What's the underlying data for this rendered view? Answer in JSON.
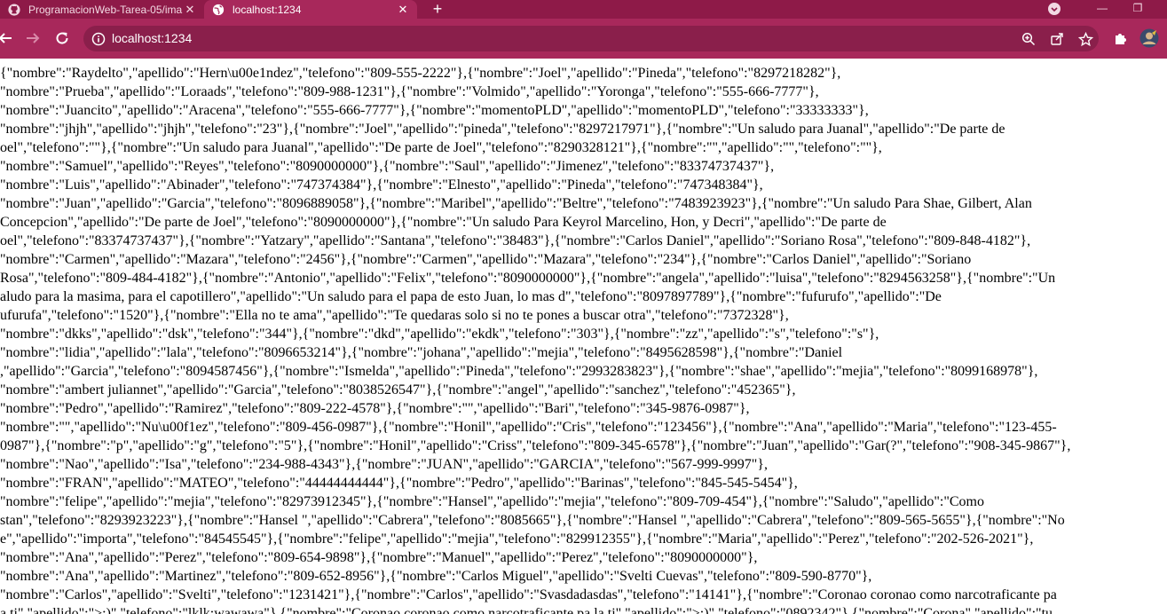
{
  "browser": {
    "tabs": [
      {
        "title": "ProgramacionWeb-Tarea-05/ima",
        "active": false,
        "icon": "github-icon"
      },
      {
        "title": "localhost:1234",
        "active": true,
        "icon": "globe-icon"
      }
    ],
    "address_bar": {
      "url": "localhost:1234",
      "icon": "info-icon"
    },
    "theme": {
      "frame": "#8e1a48",
      "toolbar": "#a8285b",
      "omnibox": "#8a1f4b"
    }
  },
  "page": {
    "lines": [
      "{\"nombre\":\"Raydelto\",\"apellido\":\"Hern\\u00e1ndez\",\"telefono\":\"809-555-2222\"},{\"nombre\":\"Joel\",\"apellido\":\"Pineda\",\"telefono\":\"8297218282\"},",
      "\"nombre\":\"Prueba\",\"apellido\":\"Loraads\",\"telefono\":\"809-988-1231\"},{\"nombre\":\"Volmido\",\"apellido\":\"Yoronga\",\"telefono\":\"555-666-7777\"},",
      "\"nombre\":\"Juancito\",\"apellido\":\"Aracena\",\"telefono\":\"555-666-7777\"},{\"nombre\":\"momentoPLD\",\"apellido\":\"momentoPLD\",\"telefono\":\"33333333\"},",
      "\"nombre\":\"jhjh\",\"apellido\":\"jhjh\",\"telefono\":\"23\"},{\"nombre\":\"Joel\",\"apellido\":\"pineda\",\"telefono\":\"8297217971\"},{\"nombre\":\"Un saludo para Juanal\",\"apellido\":\"De parte de",
      "oel\",\"telefono\":\"\"},{\"nombre\":\"Un saludo para Juanal\",\"apellido\":\"De parte de Joel\",\"telefono\":\"8290328121\"},{\"nombre\":\"\",\"apellido\":\"\",\"telefono\":\"\"},",
      "\"nombre\":\"Samuel\",\"apellido\":\"Reyes\",\"telefono\":\"8090000000\"},{\"nombre\":\"Saul\",\"apellido\":\"Jimenez\",\"telefono\":\"83374737437\"},",
      "\"nombre\":\"Luis\",\"apellido\":\"Abinader\",\"telefono\":\"747374384\"},{\"nombre\":\"Elnesto\",\"apellido\":\"Pineda\",\"telefono\":\"747348384\"},",
      "\"nombre\":\"Juan\",\"apellido\":\"Garcia\",\"telefono\":\"8096889058\"},{\"nombre\":\"Maribel\",\"apellido\":\"Beltre\",\"telefono\":\"7483923923\"},{\"nombre\":\"Un saludo Para Shae, Gilbert, Alan",
      "Concepcion\",\"apellido\":\"De parte de Joel\",\"telefono\":\"8090000000\"},{\"nombre\":\"Un saludo Para Keyrol Marcelino, Hon, y Decri\",\"apellido\":\"De parte de",
      "oel\",\"telefono\":\"83374737437\"},{\"nombre\":\"Yatzary\",\"apellido\":\"Santana\",\"telefono\":\"38483\"},{\"nombre\":\"Carlos Daniel\",\"apellido\":\"Soriano Rosa\",\"telefono\":\"809-848-4182\"},",
      "\"nombre\":\"Carmen\",\"apellido\":\"Mazara\",\"telefono\":\"2456\"},{\"nombre\":\"Carmen\",\"apellido\":\"Mazara\",\"telefono\":\"234\"},{\"nombre\":\"Carlos Daniel\",\"apellido\":\"Soriano",
      "Rosa\",\"telefono\":\"809-484-4182\"},{\"nombre\":\"Antonio\",\"apellido\":\"Felix\",\"telefono\":\"8090000000\"},{\"nombre\":\"angela\",\"apellido\":\"luisa\",\"telefono\":\"8294563258\"},{\"nombre\":\"Un",
      "aludo para la masima, para el capotillero\",\"apellido\":\"Un saludo para el papa de esto Juan, lo mas d\",\"telefono\":\"8097897789\"},{\"nombre\":\"fufurufo\",\"apellido\":\"De",
      "ufurufa\",\"telefono\":\"1520\"},{\"nombre\":\"Ella no te ama\",\"apellido\":\"Te quedaras solo si no te pones a buscar otra\",\"telefono\":\"7372328\"},",
      "\"nombre\":\"dkks\",\"apellido\":\"dsk\",\"telefono\":\"344\"},{\"nombre\":\"dkd\",\"apellido\":\"ekdk\",\"telefono\":\"303\"},{\"nombre\":\"zz\",\"apellido\":\"s\",\"telefono\":\"s\"},",
      "\"nombre\":\"lidia\",\"apellido\":\"lala\",\"telefono\":\"8096653214\"},{\"nombre\":\"johana\",\"apellido\":\"mejia\",\"telefono\":\"8495628598\"},{\"nombre\":\"Daniel",
      ",\"apellido\":\"Garcia\",\"telefono\":\"8094587456\"},{\"nombre\":\"Ismelda\",\"apellido\":\"Pineda\",\"telefono\":\"2993283823\"},{\"nombre\":\"shae\",\"apellido\":\"mejia\",\"telefono\":\"8099168978\"},",
      "\"nombre\":\"ambert juliannet\",\"apellido\":\"Garcia\",\"telefono\":\"8038526547\"},{\"nombre\":\"angel\",\"apellido\":\"sanchez\",\"telefono\":\"452365\"},",
      "\"nombre\":\"Pedro\",\"apellido\":\"Ramirez\",\"telefono\":\"809-222-4578\"},{\"nombre\":\"\",\"apellido\":\"Bari\",\"telefono\":\"345-9876-0987\"},",
      "\"nombre\":\"\",\"apellido\":\"Nu\\u00f1ez\",\"telefono\":\"809-456-0987\"},{\"nombre\":\"Honil\",\"apellido\":\"Cris\",\"telefono\":\"123456\"},{\"nombre\":\"Ana\",\"apellido\":\"Maria\",\"telefono\":\"123-455-",
      "0987\"},{\"nombre\":\"p\",\"apellido\":\"g\",\"telefono\":\"5\"},{\"nombre\":\"Honil\",\"apellido\":\"Criss\",\"telefono\":\"809-345-6578\"},{\"nombre\":\"Juan\",\"apellido\":\"Gar(?\",\"telefono\":\"908-345-9867\"},",
      "\"nombre\":\"Nao\",\"apellido\":\"Isa\",\"telefono\":\"234-988-4343\"},{\"nombre\":\"JUAN\",\"apellido\":\"GARCIA\",\"telefono\":\"567-999-9997\"},",
      "\"nombre\":\"FRAN\",\"apellido\":\"MATEO\",\"telefono\":\"44444444444\"},{\"nombre\":\"Pedro\",\"apellido\":\"Barinas\",\"telefono\":\"845-545-5454\"},",
      "\"nombre\":\"felipe\",\"apellido\":\"mejia\",\"telefono\":\"82973912345\"},{\"nombre\":\"Hansel\",\"apellido\":\"mejia\",\"telefono\":\"809-709-454\"},{\"nombre\":\"Saludo\",\"apellido\":\"Como",
      "stan\",\"telefono\":\"8293923223\"},{\"nombre\":\"Hansel \",\"apellido\":\"Cabrera\",\"telefono\":\"8085665\"},{\"nombre\":\"Hansel \",\"apellido\":\"Cabrera\",\"telefono\":\"809-565-5655\"},{\"nombre\":\"No",
      "e\",\"apellido\":\"importa\",\"telefono\":\"84545545\"},{\"nombre\":\"felipe\",\"apellido\":\"mejia\",\"telefono\":\"829912355\"},{\"nombre\":\"Maria\",\"apellido\":\"Perez\",\"telefono\":\"202-526-2021\"},",
      "\"nombre\":\"Ana\",\"apellido\":\"Perez\",\"telefono\":\"809-654-9898\"},{\"nombre\":\"Manuel\",\"apellido\":\"Perez\",\"telefono\":\"8090000000\"},",
      "\"nombre\":\"Ana\",\"apellido\":\"Martinez\",\"telefono\":\"809-652-8956\"},{\"nombre\":\"Carlos Miguel\",\"apellido\":\"Svelti Cuevas\",\"telefono\":\"809-590-8770\"},",
      "\"nombre\":\"Carlos\",\"apellido\":\"Svelti\",\"telefono\":\"1231421\"},{\"nombre\":\"Carlos\",\"apellido\":\"Svasdadasdas\",\"telefono\":\"14141\"},{\"nombre\":\"Coronao coronao como narcotraficante pa",
      "a ti\",\"apellido\":\">:)\",\"telefono\":\"lklk:wawawa\"},{\"nombre\":\"Coronao coronao como narcotraficante pa la ti\",\"apellido\":\">:)\",\"telefono\":\"0892342\"},{\"nombre\":\"Corona\",\"apellido\":\"tu"
    ]
  }
}
